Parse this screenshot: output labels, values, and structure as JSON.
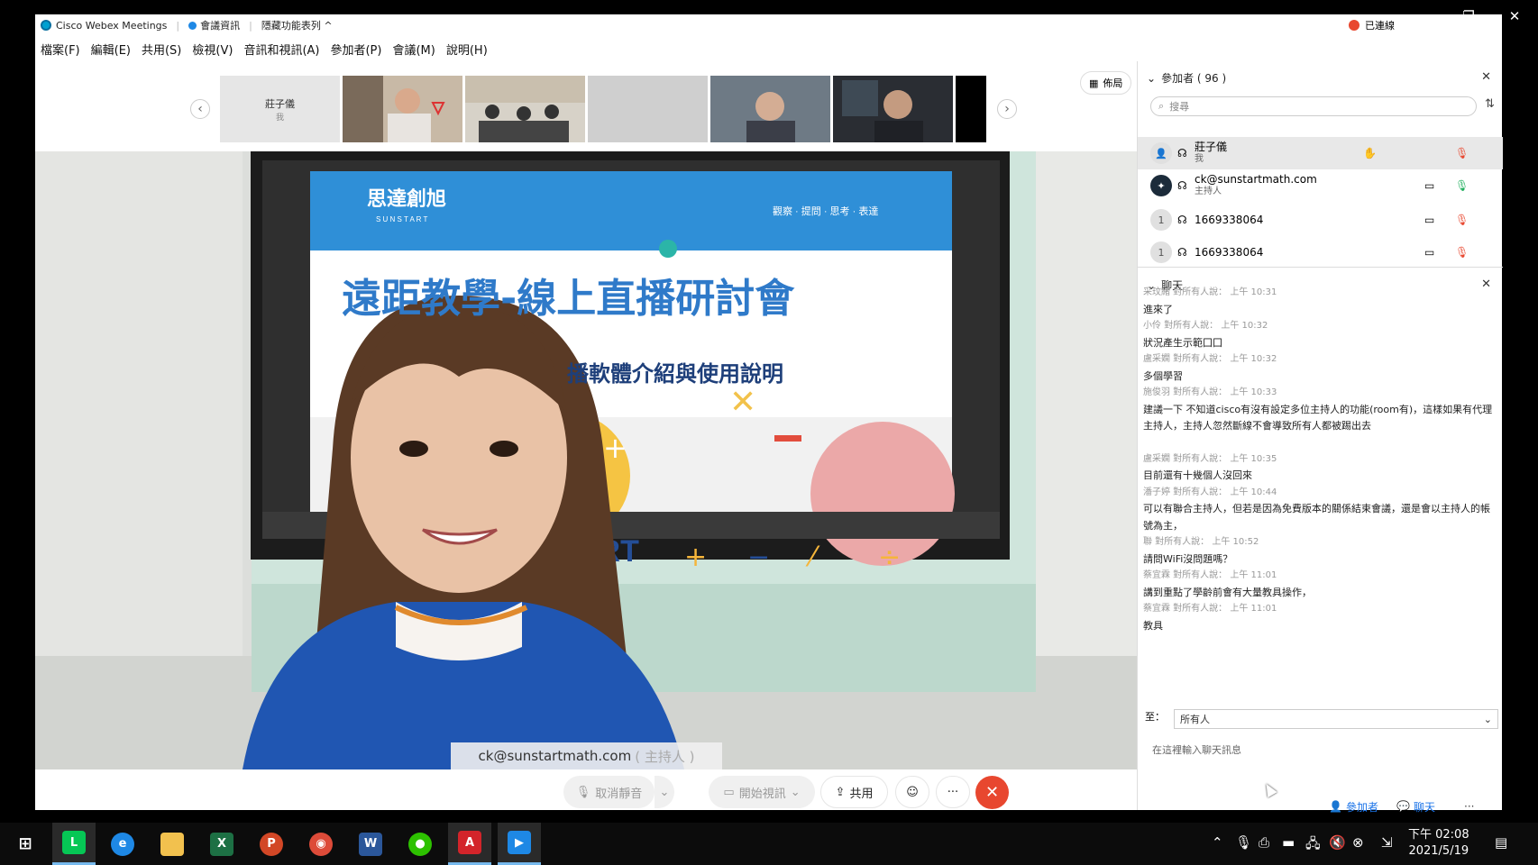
{
  "titlebar": {
    "app_name": "Cisco Webex Meetings",
    "meeting_info": "會議資訊",
    "hide_menu": "隱藏功能表列 ^",
    "connection": "已連線"
  },
  "window_controls": {
    "minimize": "–",
    "restore": "❐",
    "close": "✕"
  },
  "menu": [
    "檔案(F)",
    "編輯(E)",
    "共用(S)",
    "檢視(V)",
    "音訊和視訊(A)",
    "參加者(P)",
    "會議(M)",
    "說明(H)"
  ],
  "strip": {
    "self_name": "莊子儀",
    "self_sub": "我",
    "layout_label": "佈局"
  },
  "stage": {
    "slide_title": "遠距教學-線上直播研討會",
    "slide_subtitle": "播軟體介紹與使用說明",
    "logo_text": "思達創旭",
    "logo_sub": "S U N S T A R T",
    "logo_tagline": "觀察 · 提問 · 思考 · 表達",
    "speaker": "ck@sunstartmath.com",
    "speaker_role": "( 主持人 )"
  },
  "controls": {
    "unmute": "取消靜音",
    "start_video": "開始視訊",
    "share": "共用"
  },
  "participants": {
    "header": "參加者 ( 96 )",
    "search_placeholder": "搜尋",
    "list": [
      {
        "name": "莊子儀",
        "sub": "我",
        "avatar": "",
        "self": true
      },
      {
        "name": "ck@sunstartmath.com",
        "sub": "主持人",
        "avatar": ""
      },
      {
        "name": "1669338064",
        "sub": "",
        "avatar": "1"
      },
      {
        "name": "1669338064",
        "sub": "",
        "avatar": "1"
      }
    ]
  },
  "chat": {
    "header": "聊天",
    "messages": [
      {
        "meta": "采玟緒 對所有人說： 上午 10:31",
        "text": "進來了"
      },
      {
        "meta": "小伶 對所有人說： 上午 10:32",
        "text": "狀況產生示範囗囗"
      },
      {
        "meta": "盧采嫻 對所有人說： 上午 10:32",
        "text": "多個學習"
      },
      {
        "meta": "施俊羽 對所有人說： 上午 10:33",
        "text": "建議一下 不知道cisco有沒有設定多位主持人的功能(room有)，這樣如果有代理主持人，主持人忽然斷線不會導致所有人都被踢出去"
      },
      {
        "meta": "盧采嫻 對所有人說： 上午 10:35",
        "text": "目前還有十幾個人沒回來"
      },
      {
        "meta": "潘子婷 對所有人說： 上午 10:44",
        "text": "可以有聯合主持人，但若是因為免費版本的關係結束會議，還是會以主持人的帳號為主，"
      },
      {
        "meta": "聯 對所有人說： 上午 10:52",
        "text": "請問WiFi沒問題嗎？"
      },
      {
        "meta": "蔡宜霖 對所有人說： 上午 11:01",
        "text": "講到重點了學齡前會有大量教具操作，"
      },
      {
        "meta": "蔡宜霖 對所有人說： 上午 11:01",
        "text": "教具"
      }
    ],
    "to_label": "至：",
    "to_value": "所有人",
    "input_placeholder": "在這裡輸入聊天訊息"
  },
  "panel_footer": {
    "participants": "參加者",
    "chat": "聊天"
  },
  "clock": {
    "time": "下午 02:08",
    "date": "2021/5/19"
  },
  "colors": {
    "end_call": "#e8472f",
    "accent": "#1a73e8"
  }
}
